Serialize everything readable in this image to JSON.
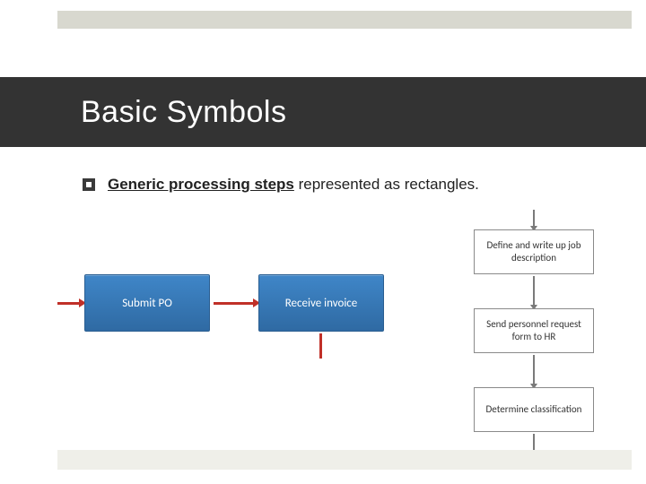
{
  "title": "Basic Symbols",
  "bullet": {
    "emphasis": "Generic processing steps",
    "rest": " represented as rectangles."
  },
  "blue_flow": {
    "box1": "Submit PO",
    "box2": "Receive invoice"
  },
  "grey_flow": {
    "box1": "Define and write up job description",
    "box2": "Send personnel request form to HR",
    "box3": "Determine classification"
  }
}
